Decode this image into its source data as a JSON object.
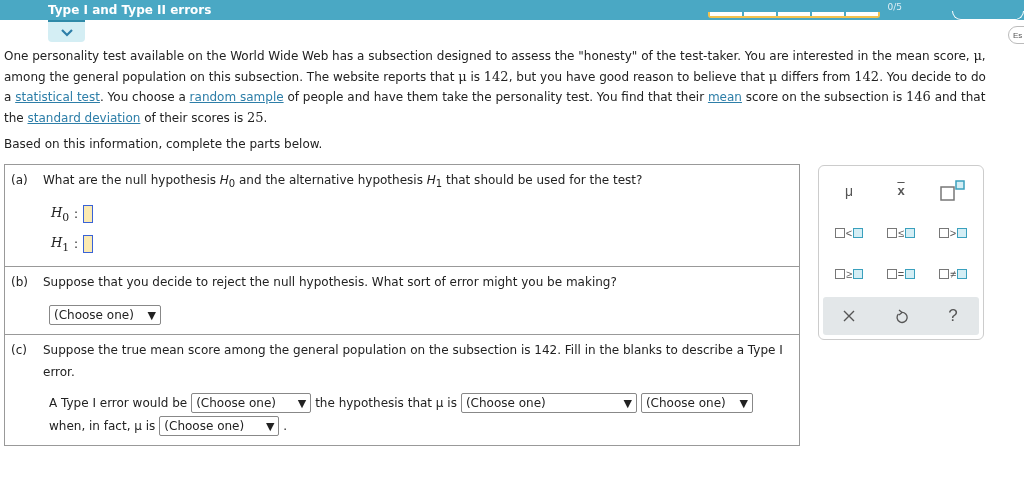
{
  "header": {
    "title": "Type I and Type II errors",
    "progress_segments": [
      {
        "filled": false
      },
      {
        "filled": false
      },
      {
        "filled": false
      },
      {
        "filled": false
      },
      {
        "filled": false
      }
    ],
    "score": "0/5",
    "side_button": "Es"
  },
  "intro": [
    {
      "kind": "text",
      "text": "One personality test available on the World Wide Web has a subsection designed to assess the \"honesty\" of the test-taker. You are interested in the mean score, "
    },
    {
      "kind": "math",
      "text": "μ"
    },
    {
      "kind": "text",
      "text": ", among the general population on this subsection. The website reports that "
    },
    {
      "kind": "math",
      "text": "μ"
    },
    {
      "kind": "text",
      "text": " is "
    },
    {
      "kind": "math",
      "text": "142"
    },
    {
      "kind": "text",
      "text": ", but you have good reason to believe that "
    },
    {
      "kind": "math",
      "text": "μ"
    },
    {
      "kind": "text",
      "text": " differs from "
    },
    {
      "kind": "math",
      "text": "142"
    },
    {
      "kind": "text",
      "text": ". You decide to do a "
    },
    {
      "kind": "link",
      "text": "statistical test"
    },
    {
      "kind": "text",
      "text": ". You choose a "
    },
    {
      "kind": "link",
      "text": "random sample"
    },
    {
      "kind": "text",
      "text": " of people and have them take the personality test. You find that their "
    },
    {
      "kind": "link",
      "text": "mean"
    },
    {
      "kind": "text",
      "text": " score on the subsection is "
    },
    {
      "kind": "math",
      "text": "146"
    },
    {
      "kind": "text",
      "text": " and that the "
    },
    {
      "kind": "link",
      "text": "standard deviation"
    },
    {
      "kind": "text",
      "text": " of their scores is "
    },
    {
      "kind": "math",
      "text": "25"
    },
    {
      "kind": "text",
      "text": "."
    }
  ],
  "instruction": "Based on this information, complete the parts below.",
  "parts": [
    {
      "label": "(a)",
      "question": "What are the null hypothesis *H*$_{0}$ and the alternative hypothesis *H*$_{1}$ that should be used for the test?",
      "kind": "hypotheses",
      "hypotheses": [
        {
          "symbol": "*H*$_{0}$",
          "colon": ":"
        },
        {
          "symbol": "*H*$_{1}$",
          "colon": ":"
        }
      ]
    },
    {
      "label": "(b)",
      "question": "Suppose that you decide to reject the null hypothesis. What sort of error might you be making?",
      "kind": "select",
      "select": "(Choose one)",
      "arrow": "▼"
    },
    {
      "label": "(c)",
      "question": "Suppose the true mean score among the general population on the subsection is 142. Fill in the blanks to describe a Type I error.",
      "kind": "sentence",
      "lines": [
        [
          {
            "kind": "text",
            "text": "A Type I error would be"
          },
          {
            "kind": "select",
            "text": "(Choose one)",
            "arrow": "▼"
          },
          {
            "kind": "text",
            "text": "the hypothesis that μ is"
          },
          {
            "kind": "select",
            "text": "(Choose one)",
            "arrow": "▼"
          },
          {
            "kind": "select",
            "text": "(Choose one)",
            "arrow": "▼"
          }
        ],
        [
          {
            "kind": "text",
            "text": "when, in fact, μ is"
          },
          {
            "kind": "select",
            "text": "(Choose one)",
            "arrow": "▼"
          },
          {
            "kind": "text",
            "text": "."
          }
        ]
      ]
    }
  ],
  "toolbox": {
    "rows": [
      [
        {
          "kind": "mu",
          "text": "μ"
        },
        {
          "kind": "xbar",
          "text": "x"
        },
        {
          "kind": "power"
        }
      ],
      [
        {
          "kind": "rel",
          "text": "<"
        },
        {
          "kind": "rel",
          "text": "≤"
        },
        {
          "kind": "rel",
          "text": ">"
        }
      ],
      [
        {
          "kind": "rel",
          "text": "≥"
        },
        {
          "kind": "rel",
          "text": "="
        },
        {
          "kind": "rel",
          "text": "≠"
        }
      ]
    ],
    "actions": [
      {
        "kind": "clear"
      },
      {
        "kind": "undo"
      },
      {
        "kind": "help",
        "text": "?"
      }
    ]
  }
}
